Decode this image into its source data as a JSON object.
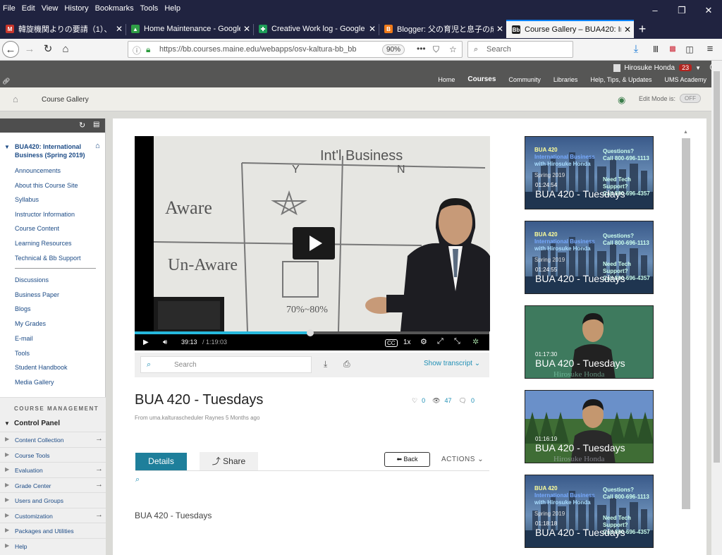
{
  "menu": [
    "File",
    "Edit",
    "View",
    "History",
    "Bookmarks",
    "Tools",
    "Help"
  ],
  "window_controls": [
    "–",
    "❐",
    "✕"
  ],
  "tabs": [
    {
      "title": "韓旋機関よりの要請（1）、",
      "icon": "gmail-icon",
      "icon_text": "M",
      "color": "#c8362b",
      "active": false
    },
    {
      "title": "Home Maintenance - Google D",
      "icon": "google-drive-icon",
      "icon_text": "▲",
      "color": "#2f9e46",
      "active": false
    },
    {
      "title": "Creative Work log - Google She",
      "icon": "google-sheets-icon",
      "icon_text": "✚",
      "color": "#1e9d58",
      "active": false
    },
    {
      "title": "Blogger: 父の育児と息子の成長",
      "icon": "blogger-icon",
      "icon_text": "B",
      "color": "#f07a19",
      "active": false
    },
    {
      "title": "Course Gallery – BUA420: Intern",
      "icon": "blackboard-icon",
      "icon_text": "Bb",
      "color": "#222",
      "active": true
    }
  ],
  "navbar": {
    "url": "https://bb.courses.maine.edu/webapps/osv-kaltura-bb_bb",
    "zoom": "90%",
    "search_placeholder": "Search"
  },
  "bb": {
    "user": "Hirosuke Honda",
    "notifications": "23",
    "nav": [
      "Home",
      "Courses",
      "Community",
      "Libraries",
      "Help, Tips, & Updates",
      "UMS Academy"
    ],
    "current_nav": "Courses",
    "breadcrumb": "Course Gallery",
    "edit_mode_label": "Edit Mode is:",
    "edit_mode_value": "OFF"
  },
  "sidebar": {
    "course_title": "BUA420: International Business (Spring 2019)",
    "links_a": [
      "Announcements",
      "About this Course Site",
      "Syllabus",
      "Instructor Information",
      "Course Content",
      "Learning Resources",
      "Technical & Bb Support"
    ],
    "links_b": [
      "Discussions",
      "Business Paper",
      "Blogs",
      "My Grades",
      "E-mail",
      "Tools",
      "Student Handbook",
      "Media Gallery"
    ],
    "course_management": "COURSE MANAGEMENT",
    "control_panel": "Control Panel",
    "cp_items": [
      "Content Collection",
      "Course Tools",
      "Evaluation",
      "Grade Center",
      "Users and Groups",
      "Customization",
      "Packages and Utilities",
      "Help"
    ]
  },
  "player": {
    "elapsed": "39:13",
    "total": "/ 1:19:03",
    "speed": "1x",
    "progress": 0.496,
    "board_text": {
      "top": "Int'l Business",
      "y": "Y",
      "n": "N",
      "aware": "Aware",
      "unaware": "Un-Aware",
      "pct": "70%~80%"
    }
  },
  "transcript": {
    "search_placeholder": "Search",
    "show": "Show transcript"
  },
  "media": {
    "title": "BUA 420 - Tuesdays",
    "from": "From uma.kalturascheduler Raynes 5 Months ago",
    "likes": "0",
    "views": "47",
    "comments": "0",
    "details": "Details",
    "share": "Share",
    "back": "Back",
    "actions": "ACTIONS",
    "description": "BUA 420 - Tuesdays"
  },
  "related": [
    {
      "duration": "01:24:54",
      "title": "BUA 420 - Tuesdays",
      "kind": "city"
    },
    {
      "duration": "01:24:55",
      "title": "BUA 420 - Tuesdays",
      "kind": "city"
    },
    {
      "duration": "01:17:30",
      "title": "BUA 420 - Tuesdays",
      "kind": "green"
    },
    {
      "duration": "01:16:19",
      "title": "BUA 420 - Tuesdays",
      "kind": "forest"
    },
    {
      "duration": "01:18:18",
      "title": "BUA 420 - Tuesdays",
      "kind": "city"
    }
  ],
  "thumb_text": {
    "course": "BUA 420",
    "subject": "International Business",
    "with": "with Hirosuke Honda",
    "questions": "Questions?",
    "call1": "Call 800-696-1113",
    "support": "Need Tech Support?",
    "call2": "Call 800-696-4357",
    "semester": "Spring 2019",
    "watermark": "Hirosuke Honda"
  }
}
